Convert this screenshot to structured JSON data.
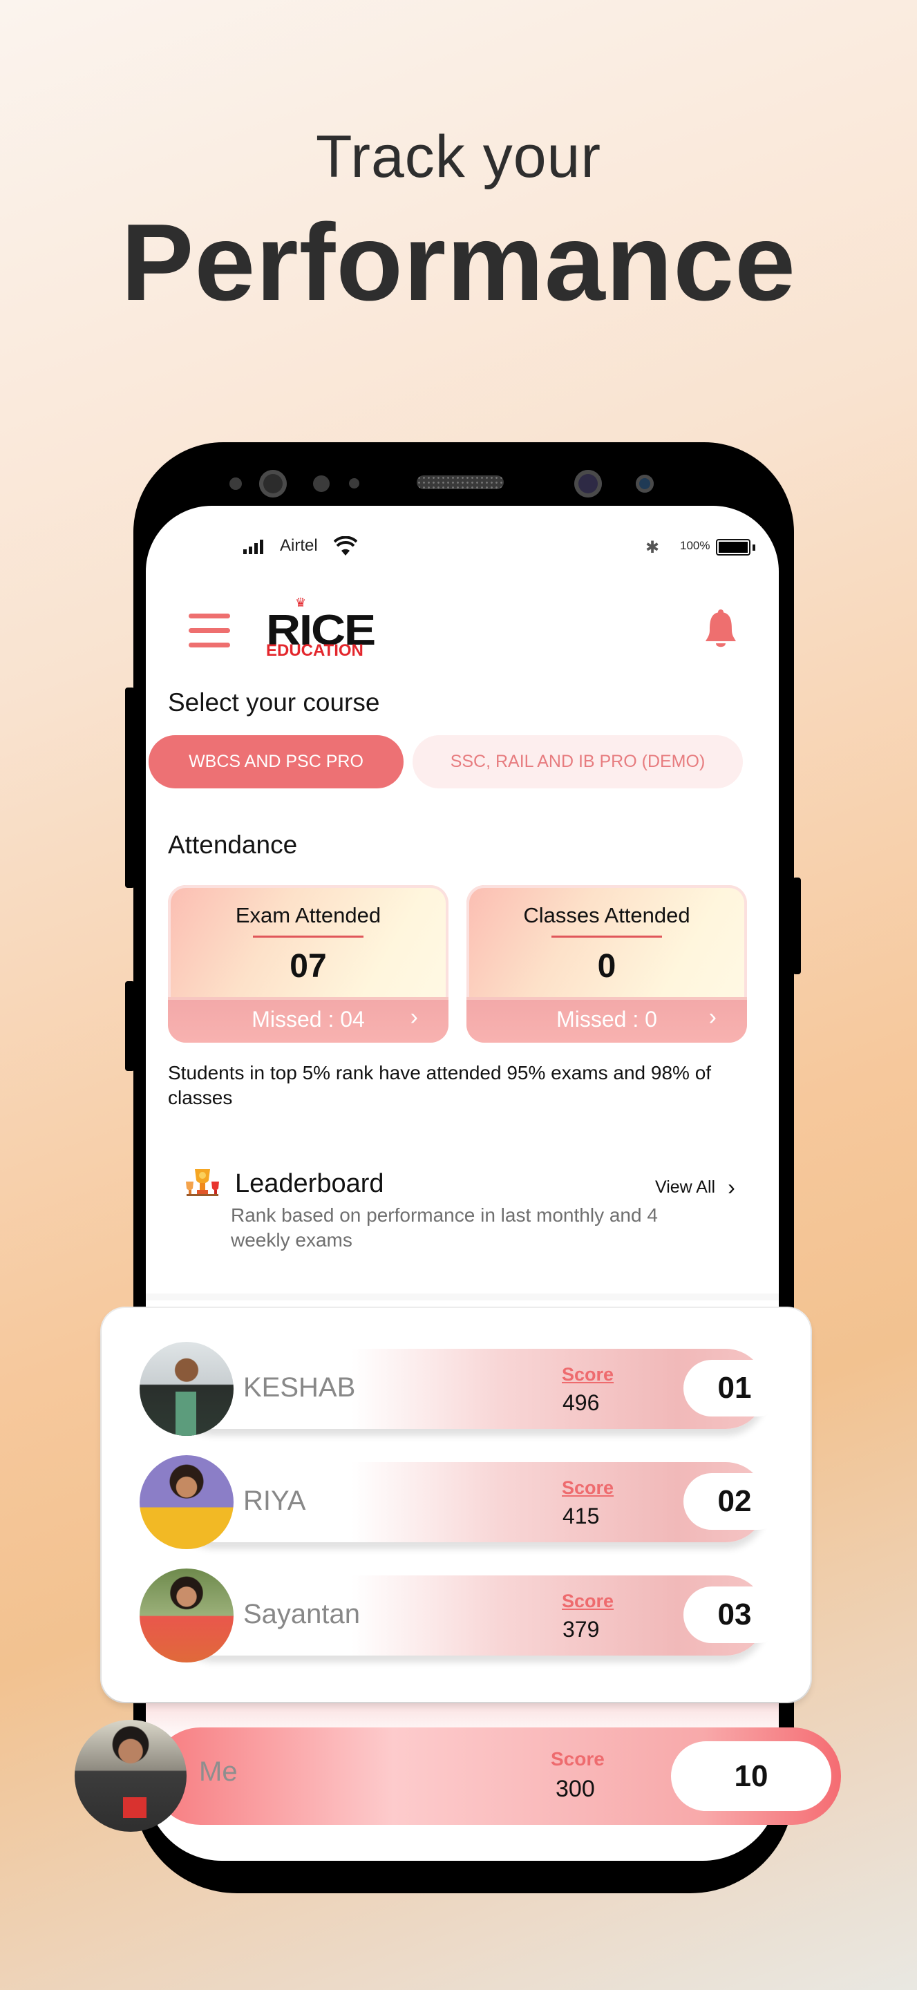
{
  "hero": {
    "line1": "Track your",
    "line2": "Performance"
  },
  "status_bar": {
    "carrier": "Airtel",
    "battery": "100%",
    "icons": [
      "signal-icon",
      "wifi-icon",
      "bluetooth-icon",
      "battery-icon"
    ]
  },
  "header": {
    "menu_icon": "hamburger-icon",
    "logo": {
      "word": "RICE",
      "sub": "EDUCATION"
    },
    "notification_icon": "bell-icon"
  },
  "course": {
    "title": "Select your course",
    "options": [
      {
        "label": "WBCS AND PSC PRO",
        "selected": true
      },
      {
        "label": "SSC, RAIL AND IB PRO (DEMO)",
        "selected": false
      }
    ]
  },
  "attendance": {
    "title": "Attendance",
    "cards": [
      {
        "title": "Exam Attended",
        "value": "07",
        "missed": "Missed : 04"
      },
      {
        "title": "Classes Attended",
        "value": "0",
        "missed": "Missed : 0"
      }
    ],
    "note": "Students in top 5% rank have attended 95% exams and 98% of classes"
  },
  "leaderboard": {
    "icon": "trophy-icon",
    "title": "Leaderboard",
    "subtitle": "Rank based on performance in last monthly and 4 weekly exams",
    "view_all": "View All",
    "score_label": "Score",
    "rows": [
      {
        "name": "KESHAB",
        "score": "496",
        "rank": "01"
      },
      {
        "name": "RIYA",
        "score": "415",
        "rank": "02"
      },
      {
        "name": "Sayantan",
        "score": "379",
        "rank": "03"
      }
    ],
    "me": {
      "name": "Me",
      "score": "300",
      "rank": "10"
    }
  },
  "colors": {
    "accent": "#ed7174",
    "accent_light": "#fdeeee",
    "logo_red": "#e3262c",
    "text_dark": "#2e2e2e"
  }
}
